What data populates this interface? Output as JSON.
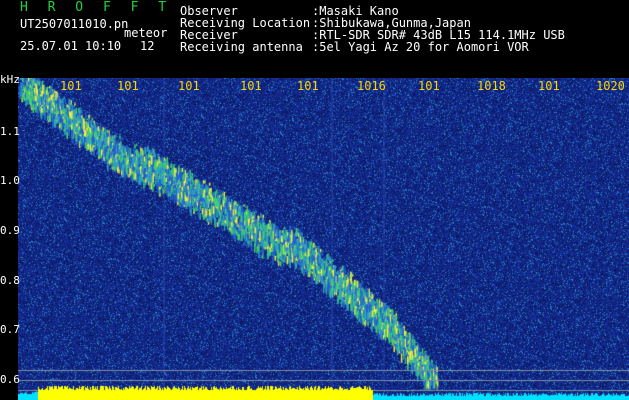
{
  "header": {
    "app_title": "H R O F F T",
    "filename": "UT2507011010.pn",
    "mode": "meteor",
    "datetime": "25.07.01 10:10",
    "count": "12",
    "fields": [
      {
        "label": "Observer",
        "value": ":Masaki Kano"
      },
      {
        "label": "Receiving Location",
        "value": ":Shibukawa,Gunma,Japan"
      },
      {
        "label": "Receiver",
        "value": ":RTL-SDR SDR# 43dB L15 114.1MHz USB"
      },
      {
        "label": "Receiving antenna",
        "value": ":5el Yagi Az 20 for Aomori VOR"
      }
    ]
  },
  "x_axis": {
    "ticks": [
      "101",
      "101",
      "101",
      "101",
      "101",
      "1016",
      "101",
      "1018",
      "101",
      "1020"
    ]
  },
  "y_axis": {
    "unit": "kHz",
    "ticks": [
      "1.1",
      "1.0",
      "0.9",
      "0.8",
      "0.7",
      "0.6"
    ]
  },
  "colors": {
    "background": "#000000",
    "plot_noise": "#0a1870",
    "signal": "#30c060",
    "tick_text": "#ffd400",
    "baseline_yellow": "#ffff00",
    "baseline_cyan": "#00e0ff"
  }
}
